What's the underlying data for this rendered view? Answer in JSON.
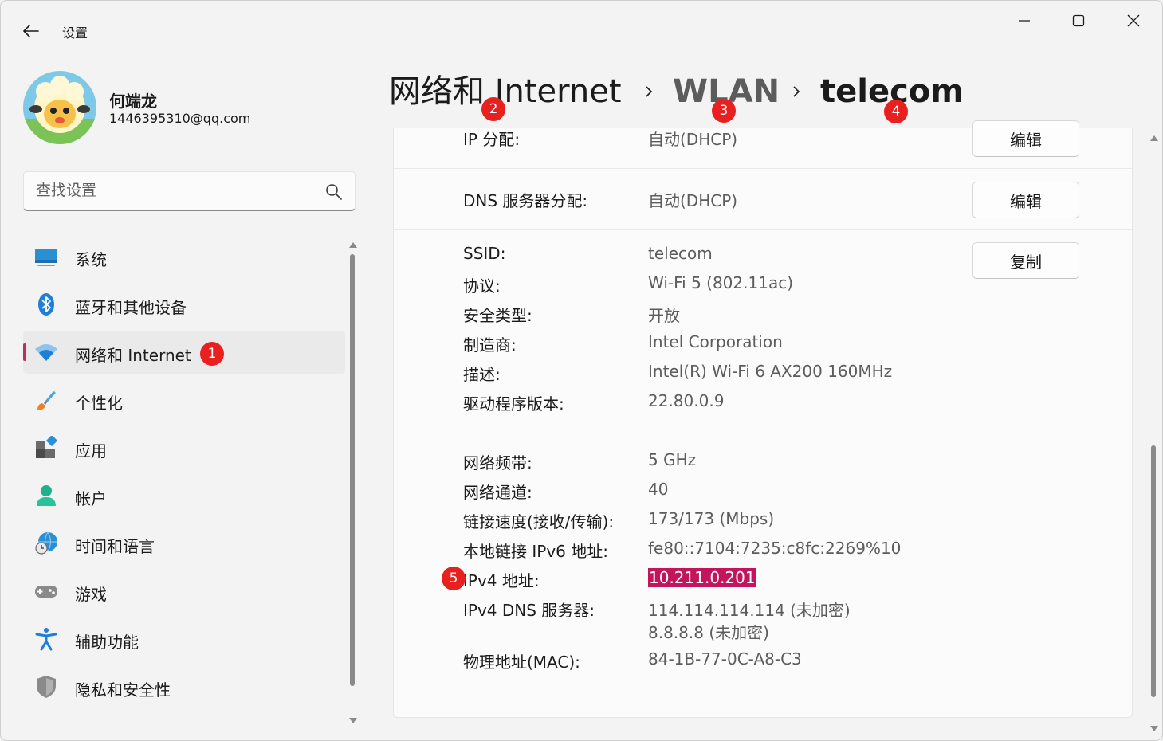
{
  "window": {
    "app_title": "设置"
  },
  "profile": {
    "name": "何端龙",
    "email": "1446395310@qq.com"
  },
  "search": {
    "placeholder": "查找设置"
  },
  "nav": {
    "items": [
      {
        "label": "系统",
        "icon": "monitor-icon"
      },
      {
        "label": "蓝牙和其他设备",
        "icon": "bluetooth-icon"
      },
      {
        "label": "网络和 Internet",
        "icon": "wifi-icon",
        "selected": true
      },
      {
        "label": "个性化",
        "icon": "paintbrush-icon"
      },
      {
        "label": "应用",
        "icon": "apps-icon"
      },
      {
        "label": "帐户",
        "icon": "person-icon"
      },
      {
        "label": "时间和语言",
        "icon": "globe-clock-icon"
      },
      {
        "label": "游戏",
        "icon": "gamepad-icon"
      },
      {
        "label": "辅助功能",
        "icon": "accessibility-icon"
      },
      {
        "label": "隐私和安全性",
        "icon": "shield-icon"
      }
    ]
  },
  "breadcrumb": {
    "items": [
      "网络和 Internet",
      "WLAN",
      "telecom"
    ]
  },
  "details": {
    "ip_assignment": {
      "label": "IP 分配:",
      "value": "自动(DHCP)",
      "button": "编辑"
    },
    "dns_assignment": {
      "label": "DNS 服务器分配:",
      "value": "自动(DHCP)",
      "button": "编辑"
    },
    "copy_button": "复制",
    "properties": [
      {
        "label": "SSID:",
        "value": "telecom"
      },
      {
        "label": "协议:",
        "value": "Wi-Fi 5 (802.11ac)"
      },
      {
        "label": "安全类型:",
        "value": "开放"
      },
      {
        "label": "制造商:",
        "value": "Intel Corporation"
      },
      {
        "label": "描述:",
        "value": "Intel(R) Wi-Fi 6 AX200 160MHz"
      },
      {
        "label": "驱动程序版本:",
        "value": "22.80.0.9"
      },
      {
        "label": "网络频带:",
        "value": "5 GHz"
      },
      {
        "label": "网络通道:",
        "value": "40"
      },
      {
        "label": "链接速度(接收/传输):",
        "value": "173/173 (Mbps)"
      },
      {
        "label": "本地链接 IPv6 地址:",
        "value": "fe80::7104:7235:c8fc:2269%10"
      },
      {
        "label": "IPv4 地址:",
        "value": "10.211.0.201"
      },
      {
        "label": "IPv4 DNS 服务器:",
        "value": "114.114.114.114 (未加密)",
        "value2": "8.8.8.8 (未加密)"
      },
      {
        "label": "物理地址(MAC):",
        "value": "84-1B-77-0C-A8-C3"
      }
    ]
  },
  "annotations": [
    "1",
    "2",
    "3",
    "4",
    "5"
  ],
  "colors": {
    "accent": "#c42b5a",
    "highlight": "#c4145b",
    "badge": "#e8201f"
  }
}
